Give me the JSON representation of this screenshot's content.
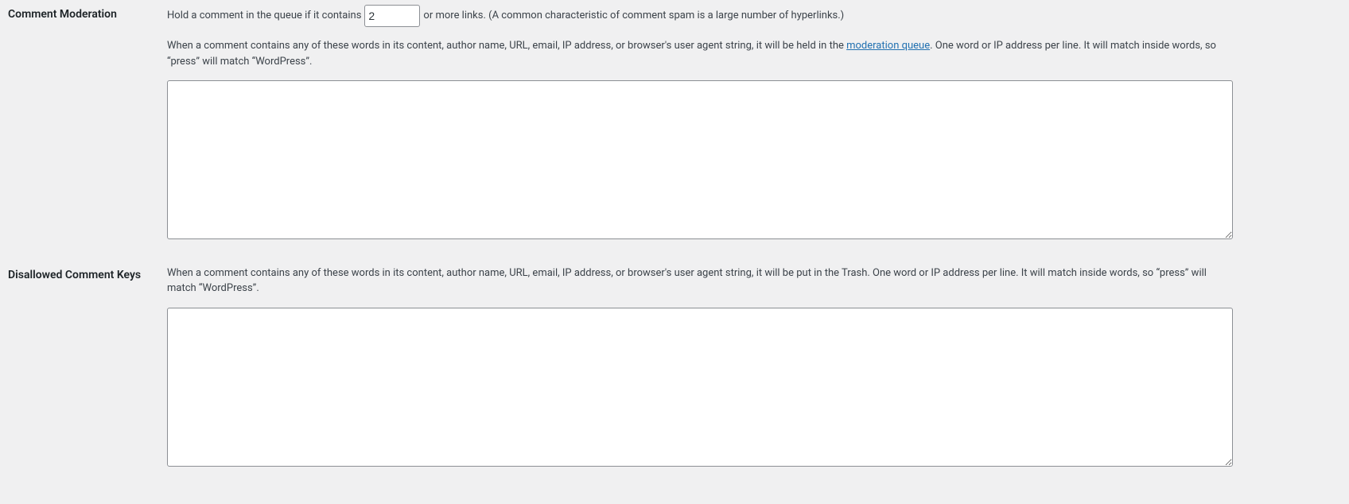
{
  "moderation": {
    "heading": "Comment Moderation",
    "hold_pre": "Hold a comment in the queue if it contains",
    "hold_value": "2",
    "hold_post": "or more links. (A common characteristic of comment spam is a large number of hyperlinks.)",
    "desc_pre": "When a comment contains any of these words in its content, author name, URL, email, IP address, or browser's user agent string, it will be held in the ",
    "link_text": "moderation queue",
    "desc_post": ". One word or IP address per line. It will match inside words, so “press” will match “WordPress”.",
    "textarea_value": ""
  },
  "disallowed": {
    "heading": "Disallowed Comment Keys",
    "desc": "When a comment contains any of these words in its content, author name, URL, email, IP address, or browser's user agent string, it will be put in the Trash. One word or IP address per line. It will match inside words, so “press” will match “WordPress”.",
    "textarea_value": ""
  }
}
